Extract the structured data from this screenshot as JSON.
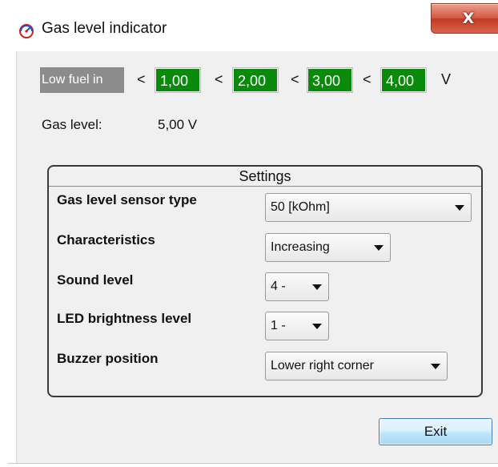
{
  "window": {
    "title": "Gas level indicator",
    "close_label": "X"
  },
  "thresholds": {
    "low_fuel_label": "Low fuel in",
    "separator": "<",
    "values": [
      "1,00",
      "2,00",
      "3,00",
      "4,00"
    ],
    "unit": "V",
    "value_color": "#0a8a0a"
  },
  "gas_level": {
    "label": "Gas level:",
    "value": "5,00  V"
  },
  "settings": {
    "title": "Settings",
    "rows": [
      {
        "label": "Gas level sensor type",
        "value": "50 [kOhm]"
      },
      {
        "label": "Characteristics",
        "value": "Increasing"
      },
      {
        "label": "Sound level",
        "value": "4 -"
      },
      {
        "label": "LED brightness level",
        "value": "1 -"
      },
      {
        "label": "Buzzer position",
        "value": "Lower right corner"
      }
    ]
  },
  "buttons": {
    "exit_label": "Exit"
  },
  "icons": {
    "app": "gas-gauge-icon",
    "close": "close-icon",
    "dropdown": "chevron-down-icon"
  }
}
